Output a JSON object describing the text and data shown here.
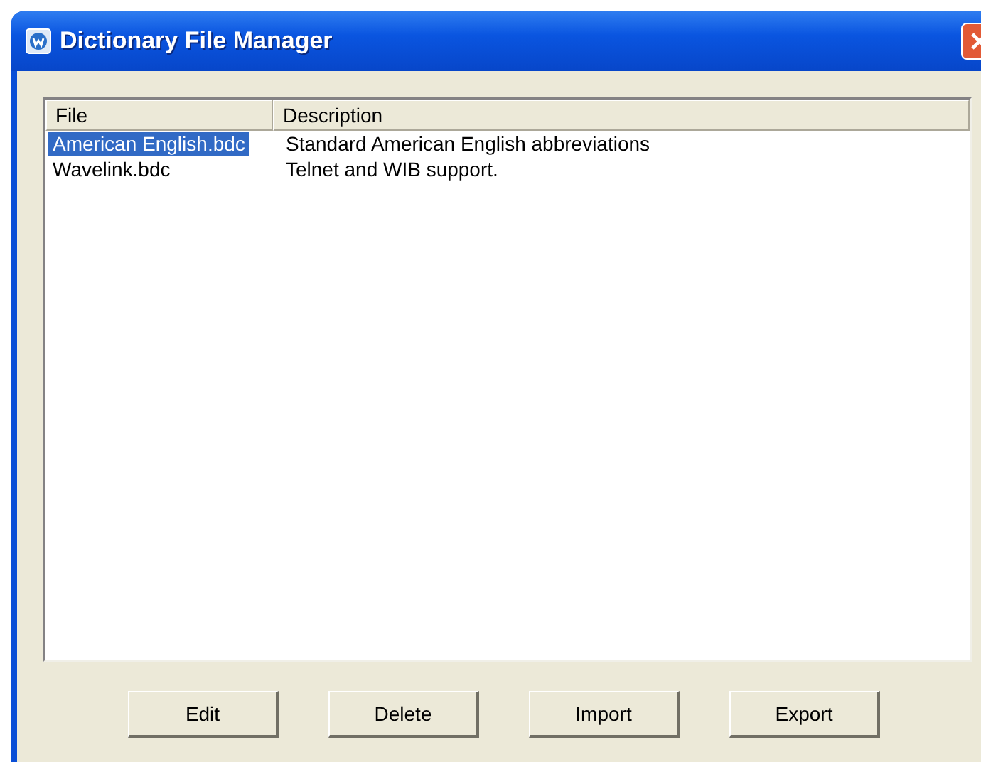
{
  "window": {
    "title": "Dictionary File Manager"
  },
  "table": {
    "columns": [
      "File",
      "Description"
    ],
    "rows": [
      {
        "file": "American English.bdc",
        "description": "Standard American English abbreviations",
        "selected": true
      },
      {
        "file": "Wavelink.bdc",
        "description": "Telnet and WIB support.",
        "selected": false
      }
    ]
  },
  "buttons": [
    "Edit",
    "Delete",
    "Import",
    "Export"
  ]
}
